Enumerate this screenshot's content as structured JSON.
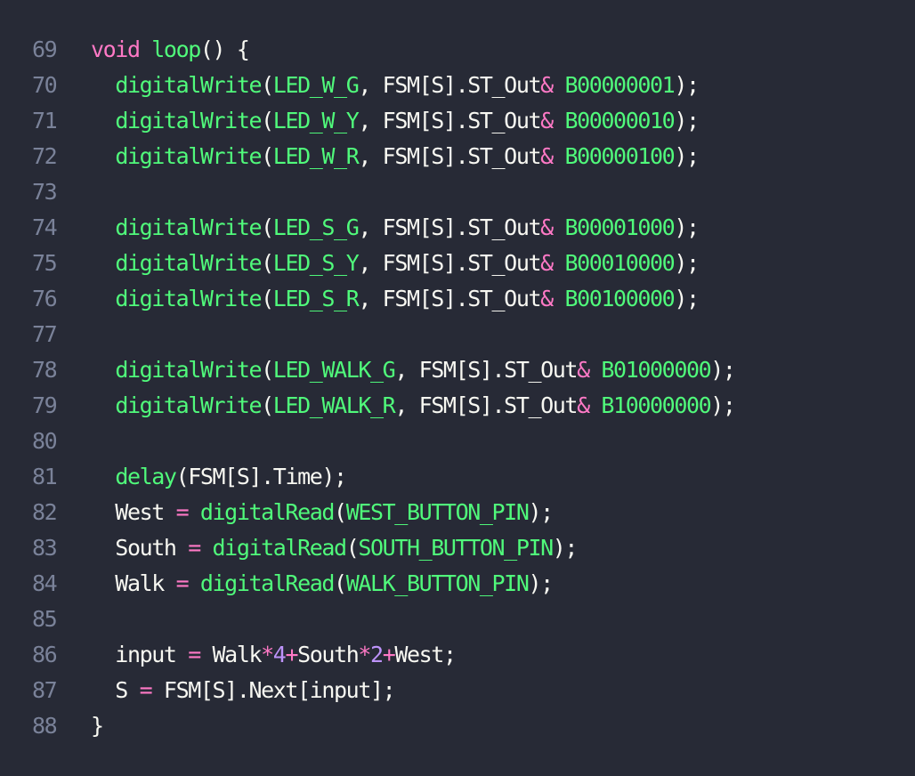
{
  "editor": {
    "colors": {
      "background": "#272a36",
      "line_number": "#7a8299",
      "plain": "#f8f8f2",
      "keyword": "#ff79c6",
      "function": "#50fa7b",
      "number": "#bd93f9"
    },
    "lines": [
      {
        "num": "69",
        "tokens": [
          {
            "t": "void",
            "c": "kw"
          },
          {
            "t": " ",
            "c": "pl"
          },
          {
            "t": "loop",
            "c": "fn"
          },
          {
            "t": "() {",
            "c": "pl"
          }
        ]
      },
      {
        "num": "70",
        "tokens": [
          {
            "t": "  ",
            "c": "pl"
          },
          {
            "t": "digitalWrite",
            "c": "fn"
          },
          {
            "t": "(",
            "c": "pl"
          },
          {
            "t": "LED_W_G",
            "c": "fn"
          },
          {
            "t": ", FSM[S].ST_Out",
            "c": "pl"
          },
          {
            "t": "&",
            "c": "op"
          },
          {
            "t": " ",
            "c": "pl"
          },
          {
            "t": "B00000001",
            "c": "fn"
          },
          {
            "t": ");",
            "c": "pl"
          }
        ]
      },
      {
        "num": "71",
        "tokens": [
          {
            "t": "  ",
            "c": "pl"
          },
          {
            "t": "digitalWrite",
            "c": "fn"
          },
          {
            "t": "(",
            "c": "pl"
          },
          {
            "t": "LED_W_Y",
            "c": "fn"
          },
          {
            "t": ", FSM[S].ST_Out",
            "c": "pl"
          },
          {
            "t": "&",
            "c": "op"
          },
          {
            "t": " ",
            "c": "pl"
          },
          {
            "t": "B00000010",
            "c": "fn"
          },
          {
            "t": ");",
            "c": "pl"
          }
        ]
      },
      {
        "num": "72",
        "tokens": [
          {
            "t": "  ",
            "c": "pl"
          },
          {
            "t": "digitalWrite",
            "c": "fn"
          },
          {
            "t": "(",
            "c": "pl"
          },
          {
            "t": "LED_W_R",
            "c": "fn"
          },
          {
            "t": ", FSM[S].ST_Out",
            "c": "pl"
          },
          {
            "t": "&",
            "c": "op"
          },
          {
            "t": " ",
            "c": "pl"
          },
          {
            "t": "B00000100",
            "c": "fn"
          },
          {
            "t": ");",
            "c": "pl"
          }
        ]
      },
      {
        "num": "73",
        "tokens": []
      },
      {
        "num": "74",
        "tokens": [
          {
            "t": "  ",
            "c": "pl"
          },
          {
            "t": "digitalWrite",
            "c": "fn"
          },
          {
            "t": "(",
            "c": "pl"
          },
          {
            "t": "LED_S_G",
            "c": "fn"
          },
          {
            "t": ", FSM[S].ST_Out",
            "c": "pl"
          },
          {
            "t": "&",
            "c": "op"
          },
          {
            "t": " ",
            "c": "pl"
          },
          {
            "t": "B00001000",
            "c": "fn"
          },
          {
            "t": ");",
            "c": "pl"
          }
        ]
      },
      {
        "num": "75",
        "tokens": [
          {
            "t": "  ",
            "c": "pl"
          },
          {
            "t": "digitalWrite",
            "c": "fn"
          },
          {
            "t": "(",
            "c": "pl"
          },
          {
            "t": "LED_S_Y",
            "c": "fn"
          },
          {
            "t": ", FSM[S].ST_Out",
            "c": "pl"
          },
          {
            "t": "&",
            "c": "op"
          },
          {
            "t": " ",
            "c": "pl"
          },
          {
            "t": "B00010000",
            "c": "fn"
          },
          {
            "t": ");",
            "c": "pl"
          }
        ]
      },
      {
        "num": "76",
        "tokens": [
          {
            "t": "  ",
            "c": "pl"
          },
          {
            "t": "digitalWrite",
            "c": "fn"
          },
          {
            "t": "(",
            "c": "pl"
          },
          {
            "t": "LED_S_R",
            "c": "fn"
          },
          {
            "t": ", FSM[S].ST_Out",
            "c": "pl"
          },
          {
            "t": "&",
            "c": "op"
          },
          {
            "t": " ",
            "c": "pl"
          },
          {
            "t": "B00100000",
            "c": "fn"
          },
          {
            "t": ");",
            "c": "pl"
          }
        ]
      },
      {
        "num": "77",
        "tokens": []
      },
      {
        "num": "78",
        "tokens": [
          {
            "t": "  ",
            "c": "pl"
          },
          {
            "t": "digitalWrite",
            "c": "fn"
          },
          {
            "t": "(",
            "c": "pl"
          },
          {
            "t": "LED_WALK_G",
            "c": "fn"
          },
          {
            "t": ", FSM[S].ST_Out",
            "c": "pl"
          },
          {
            "t": "&",
            "c": "op"
          },
          {
            "t": " ",
            "c": "pl"
          },
          {
            "t": "B01000000",
            "c": "fn"
          },
          {
            "t": ");",
            "c": "pl"
          }
        ]
      },
      {
        "num": "79",
        "tokens": [
          {
            "t": "  ",
            "c": "pl"
          },
          {
            "t": "digitalWrite",
            "c": "fn"
          },
          {
            "t": "(",
            "c": "pl"
          },
          {
            "t": "LED_WALK_R",
            "c": "fn"
          },
          {
            "t": ", FSM[S].ST_Out",
            "c": "pl"
          },
          {
            "t": "&",
            "c": "op"
          },
          {
            "t": " ",
            "c": "pl"
          },
          {
            "t": "B10000000",
            "c": "fn"
          },
          {
            "t": ");",
            "c": "pl"
          }
        ]
      },
      {
        "num": "80",
        "tokens": []
      },
      {
        "num": "81",
        "tokens": [
          {
            "t": "  ",
            "c": "pl"
          },
          {
            "t": "delay",
            "c": "fn"
          },
          {
            "t": "(FSM[S].Time);",
            "c": "pl"
          }
        ]
      },
      {
        "num": "82",
        "tokens": [
          {
            "t": "  West ",
            "c": "pl"
          },
          {
            "t": "=",
            "c": "op"
          },
          {
            "t": " ",
            "c": "pl"
          },
          {
            "t": "digitalRead",
            "c": "fn"
          },
          {
            "t": "(",
            "c": "pl"
          },
          {
            "t": "WEST_BUTTON_PIN",
            "c": "fn"
          },
          {
            "t": ");",
            "c": "pl"
          }
        ]
      },
      {
        "num": "83",
        "tokens": [
          {
            "t": "  South ",
            "c": "pl"
          },
          {
            "t": "=",
            "c": "op"
          },
          {
            "t": " ",
            "c": "pl"
          },
          {
            "t": "digitalRead",
            "c": "fn"
          },
          {
            "t": "(",
            "c": "pl"
          },
          {
            "t": "SOUTH_BUTTON_PIN",
            "c": "fn"
          },
          {
            "t": ");",
            "c": "pl"
          }
        ]
      },
      {
        "num": "84",
        "tokens": [
          {
            "t": "  Walk ",
            "c": "pl"
          },
          {
            "t": "=",
            "c": "op"
          },
          {
            "t": " ",
            "c": "pl"
          },
          {
            "t": "digitalRead",
            "c": "fn"
          },
          {
            "t": "(",
            "c": "pl"
          },
          {
            "t": "WALK_BUTTON_PIN",
            "c": "fn"
          },
          {
            "t": ");",
            "c": "pl"
          }
        ]
      },
      {
        "num": "85",
        "tokens": []
      },
      {
        "num": "86",
        "tokens": [
          {
            "t": "  input ",
            "c": "pl"
          },
          {
            "t": "=",
            "c": "op"
          },
          {
            "t": " Walk",
            "c": "pl"
          },
          {
            "t": "*",
            "c": "op"
          },
          {
            "t": "4",
            "c": "num"
          },
          {
            "t": "+",
            "c": "op"
          },
          {
            "t": "South",
            "c": "pl"
          },
          {
            "t": "*",
            "c": "op"
          },
          {
            "t": "2",
            "c": "num"
          },
          {
            "t": "+",
            "c": "op"
          },
          {
            "t": "West;",
            "c": "pl"
          }
        ]
      },
      {
        "num": "87",
        "tokens": [
          {
            "t": "  S ",
            "c": "pl"
          },
          {
            "t": "=",
            "c": "op"
          },
          {
            "t": " FSM[S].Next[input];",
            "c": "pl"
          }
        ]
      },
      {
        "num": "88",
        "tokens": [
          {
            "t": "}",
            "c": "pl"
          }
        ]
      }
    ]
  }
}
